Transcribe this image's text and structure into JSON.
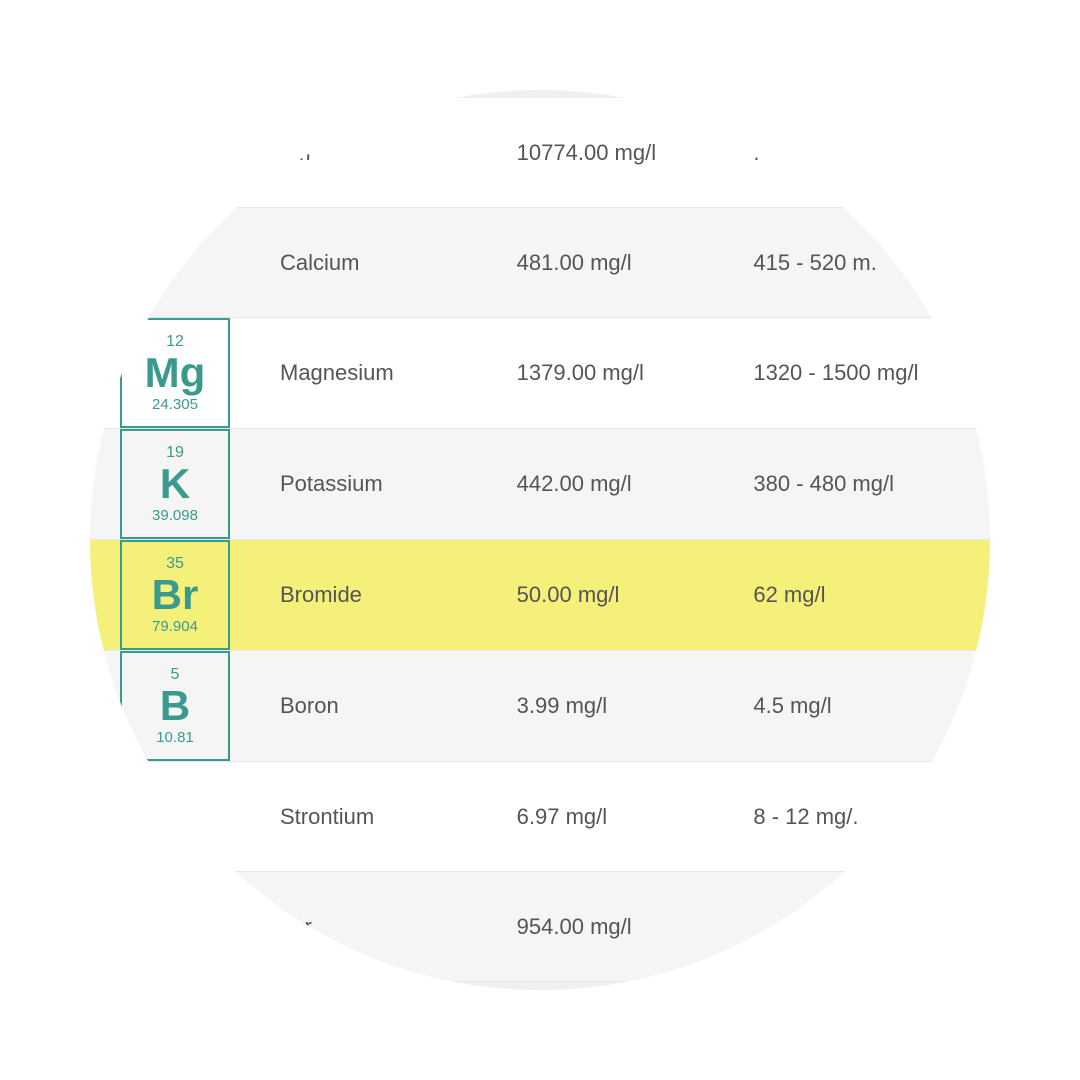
{
  "rows": [
    {
      "id": "sodium-partial",
      "partial": true,
      "partial_type": "top",
      "element": null,
      "element_label": "um",
      "name": "",
      "value": "10774.00 mg/l",
      "range": ".",
      "highlighted": false
    },
    {
      "id": "calcium",
      "partial": false,
      "element": null,
      "element_label": "",
      "name": "Calcium",
      "value": "481.00 mg/l",
      "range": "415 - 520 m.",
      "highlighted": false
    },
    {
      "id": "magnesium",
      "partial": false,
      "element": {
        "atomic_number": "12",
        "symbol": "Mg",
        "atomic_weight": "24.305"
      },
      "name": "Magnesium",
      "value": "1379.00 mg/l",
      "range": "1320 - 1500 mg/l",
      "highlighted": false
    },
    {
      "id": "potassium",
      "partial": false,
      "element": {
        "atomic_number": "19",
        "symbol": "K",
        "atomic_weight": "39.098"
      },
      "name": "Potassium",
      "value": "442.00 mg/l",
      "range": "380 - 480 mg/l",
      "highlighted": false
    },
    {
      "id": "bromide",
      "partial": false,
      "element": {
        "atomic_number": "35",
        "symbol": "Br",
        "atomic_weight": "79.904"
      },
      "name": "Bromide",
      "value": "50.00 mg/l",
      "range": "62 mg/l",
      "highlighted": true
    },
    {
      "id": "boron",
      "partial": false,
      "element": {
        "atomic_number": "5",
        "symbol": "B",
        "atomic_weight": "10.81"
      },
      "name": "Boron",
      "value": "3.99 mg/l",
      "range": "4.5 mg/l",
      "highlighted": false
    },
    {
      "id": "strontium",
      "partial": false,
      "element": null,
      "name": "Strontium",
      "value": "6.97 mg/l",
      "range": "8 - 12 mg/.",
      "highlighted": false
    },
    {
      "id": "sulfur-partial",
      "partial": true,
      "partial_type": "bottom",
      "element": null,
      "element_label": "hur",
      "name": "",
      "value": "954.00 mg/l",
      "range": "",
      "highlighted": false
    }
  ],
  "colors": {
    "teal": "#3a9a8e",
    "highlight_yellow": "#f5f07a",
    "text_gray": "#555555"
  }
}
